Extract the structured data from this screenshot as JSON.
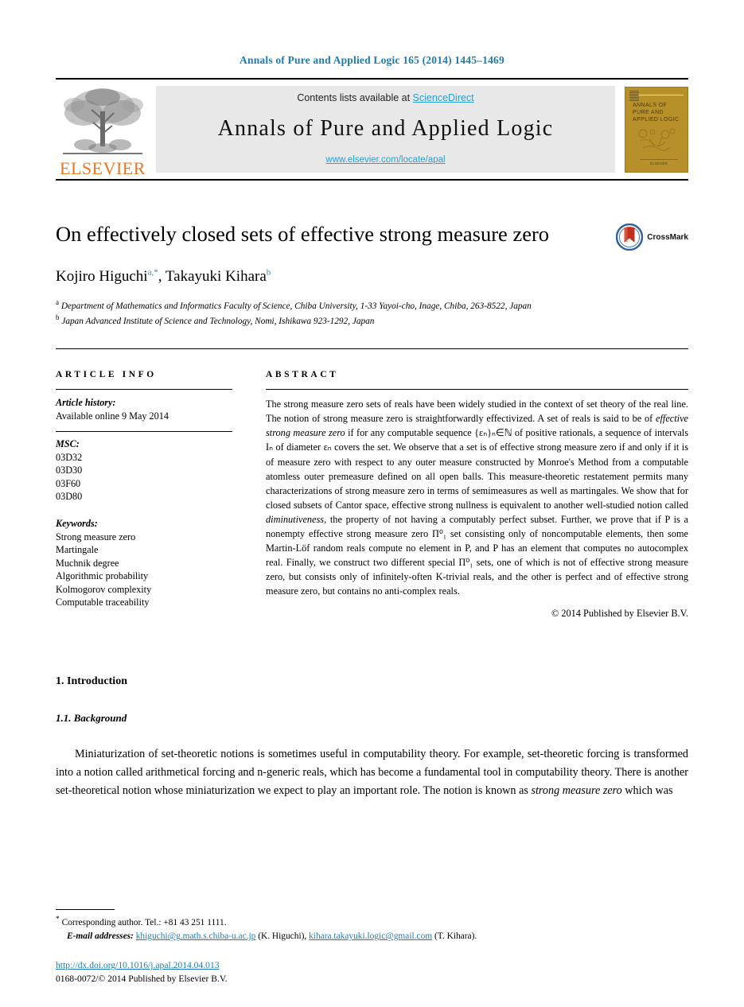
{
  "running_head": "Annals of Pure and Applied Logic 165 (2014) 1445–1469",
  "masthead": {
    "publisher_name": "ELSEVIER",
    "publisher_logo_icon": "elsevier-tree-icon",
    "contents_prefix": "Contents lists available at ",
    "sciencedirect_link": "ScienceDirect",
    "journal_title": "Annals of Pure and Applied Logic",
    "journal_url": "www.elsevier.com/locate/apal",
    "cover": {
      "title_lines": [
        "ANNALS OF",
        "PURE AND",
        "APPLIED LOGIC"
      ],
      "footer_text": "ELSEVIER",
      "color": "#b8902a"
    }
  },
  "article": {
    "title": "On effectively closed sets of effective strong measure zero",
    "authors": [
      {
        "name": "Kojiro Higuchi",
        "marks": "a,*"
      },
      {
        "name": "Takayuki Kihara",
        "marks": "b"
      }
    ],
    "authors_separator": ", ",
    "affiliations": [
      {
        "mark": "a",
        "text": "Department of Mathematics and Informatics Faculty of Science, Chiba University, 1-33 Yayoi-cho, Inage, Chiba, 263-8522, Japan"
      },
      {
        "mark": "b",
        "text": "Japan Advanced Institute of Science and Technology, Nomi, Ishikawa 923-1292, Japan"
      }
    ],
    "crossmark_label": "CrossMark"
  },
  "info": {
    "heading": "ARTICLE INFO",
    "history_label": "Article history:",
    "history_value": "Available online 9 May 2014",
    "msc_label": "MSC:",
    "msc_codes": [
      "03D32",
      "03D30",
      "03F60",
      "03D80"
    ],
    "keywords_label": "Keywords:",
    "keywords": [
      "Strong measure zero",
      "Martingale",
      "Muchnik degree",
      "Algorithmic probability",
      "Kolmogorov complexity",
      "Computable traceability"
    ]
  },
  "abstract": {
    "heading": "ABSTRACT",
    "paragraph_1": "The strong measure zero sets of reals have been widely studied in the context of set theory of the real line. The notion of strong measure zero is straightforwardly effectivized. A set of reals is said to be of ",
    "emph_1": "effective strong measure zero",
    "paragraph_2": " if for any computable sequence {εₙ}ₙ∈ℕ of positive rationals, a sequence of intervals Iₙ of diameter εₙ covers the set. We observe that a set is of effective strong measure zero if and only if it is of measure zero with respect to any outer measure constructed by Monroe's Method from a computable atomless outer premeasure defined on all open balls. This measure-theoretic restatement permits many characterizations of strong measure zero in terms of semimeasures as well as martingales. We show that for closed subsets of Cantor space, effective strong nullness is equivalent to another well-studied notion called ",
    "emph_2": "diminutiveness",
    "paragraph_3": ", the property of not having a computably perfect subset. Further, we prove that if P is a nonempty effective strong measure zero Π⁰₁ set consisting only of noncomputable elements, then some Martin-Löf random reals compute no element in P, and P has an element that computes no autocomplex real. Finally, we construct two different special Π⁰₁ sets, one of which is not of effective strong measure zero, but consists only of infinitely-often K-trivial reals, and the other is perfect and of effective strong measure zero, but contains no anti-complex reals.",
    "copyright": "© 2014 Published by Elsevier B.V."
  },
  "body": {
    "section_number_title": "1. Introduction",
    "subsection_number_title": "1.1. Background",
    "paragraph_a": "Miniaturization of set-theoretic notions is sometimes useful in computability theory. For example, set-theoretic forcing is transformed into a notion called arithmetical forcing and n-generic reals, which has become a fundamental tool in computability theory. There is another set-theoretical notion whose miniaturization we expect to play an important role. The notion is known as ",
    "paragraph_a_emph": "strong measure zero",
    "paragraph_a_tail": " which was"
  },
  "footer": {
    "corresponding_mark": "*",
    "corresponding_text": "Corresponding author. Tel.: +81 43 251 1111.",
    "email_label": "E-mail addresses:",
    "email_1": "khiguchi@g.math.s.chiba-u.ac.jp",
    "email_1_owner": " (K. Higuchi), ",
    "email_2": "kihara.takayuki.logic@gmail.com",
    "email_2_owner": " (T. Kihara).",
    "doi_url": "http://dx.doi.org/10.1016/j.apal.2014.04.013",
    "issn_line": "0168-0072/© 2014 Published by Elsevier B.V."
  },
  "colors": {
    "link_blue": "#1c7cb0",
    "sciencedirect_blue": "#2a9fd6",
    "elsevier_orange": "#e87722",
    "cover_gold": "#b8902a"
  }
}
